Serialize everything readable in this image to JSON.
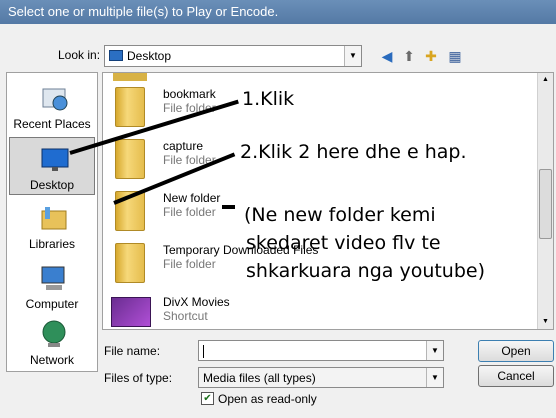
{
  "window": {
    "title": "Select one or multiple file(s) to Play or Encode."
  },
  "lookin": {
    "label": "Look in:",
    "value": "Desktop"
  },
  "places": [
    {
      "label": "Recent Places",
      "icon": "recent-places-icon"
    },
    {
      "label": "Desktop",
      "icon": "desktop-icon"
    },
    {
      "label": "Libraries",
      "icon": "libraries-icon"
    },
    {
      "label": "Computer",
      "icon": "computer-icon"
    },
    {
      "label": "Network",
      "icon": "network-icon"
    }
  ],
  "files": [
    {
      "name": "bookmark",
      "type": "File folder"
    },
    {
      "name": "capture",
      "type": "File folder"
    },
    {
      "name": "New folder",
      "type": "File folder"
    },
    {
      "name": "Temporary Downloaded Files",
      "type": "File folder"
    },
    {
      "name": "DivX Movies",
      "type": "Shortcut"
    }
  ],
  "annotations": {
    "a1": "1.Klik",
    "a2": "2.Klik 2 here dhe e hap.",
    "a3_line1": "(Ne new folder kemi",
    "a3_line2": "skedaret video flv te",
    "a3_line3": "shkarkuara nga youtube)"
  },
  "filename": {
    "label": "File name:",
    "value": ""
  },
  "filetype": {
    "label": "Files of type:",
    "value": "Media files (all types)"
  },
  "readonly": {
    "label": "Open as read-only",
    "checked": true
  },
  "buttons": {
    "open": "Open",
    "cancel": "Cancel"
  }
}
